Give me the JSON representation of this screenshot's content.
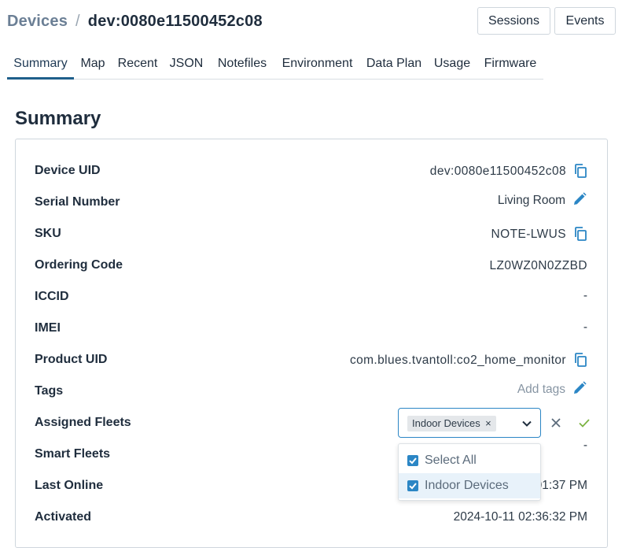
{
  "breadcrumb": {
    "parent": "Devices",
    "separator": "/",
    "current": "dev:0080e11500452c08"
  },
  "header_buttons": {
    "sessions": "Sessions",
    "events": "Events"
  },
  "tabs": [
    {
      "label": "Summary",
      "active": true
    },
    {
      "label": "Map"
    },
    {
      "label": "Recent"
    },
    {
      "label": "JSON"
    },
    {
      "label": "Notefiles"
    },
    {
      "label": "Environment"
    },
    {
      "label": "Data Plan"
    },
    {
      "label": "Usage"
    },
    {
      "label": "Firmware"
    }
  ],
  "section_title": "Summary",
  "fields": {
    "device_uid": {
      "label": "Device UID",
      "value": "dev:0080e11500452c08"
    },
    "serial_number": {
      "label": "Serial Number",
      "value": "Living Room"
    },
    "sku": {
      "label": "SKU",
      "value": "NOTE-LWUS"
    },
    "ordering_code": {
      "label": "Ordering Code",
      "value": "LZ0WZ0N0ZZBD"
    },
    "iccid": {
      "label": "ICCID",
      "value": "-"
    },
    "imei": {
      "label": "IMEI",
      "value": "-"
    },
    "product_uid": {
      "label": "Product UID",
      "value": "com.blues.tvantoll:co2_home_monitor"
    },
    "tags": {
      "label": "Tags",
      "value": "Add tags"
    },
    "assigned_fleets": {
      "label": "Assigned Fleets"
    },
    "smart_fleets": {
      "label": "Smart Fleets",
      "value": "-"
    },
    "last_online": {
      "label": "Last Online",
      "value": "01:37 PM"
    },
    "activated": {
      "label": "Activated",
      "value": "2024-10-11 02:36:32 PM"
    }
  },
  "fleet_select": {
    "chip": "Indoor Devices",
    "chip_remove": "×",
    "options": [
      {
        "label": "Select All",
        "checked": true
      },
      {
        "label": "Indoor Devices",
        "checked": true
      }
    ]
  },
  "colors": {
    "accent": "#2b86c5",
    "confirm": "#7cb342",
    "tab_active_underline": "#1f5f8b"
  },
  "icons": {
    "copy": "copy-icon",
    "edit": "pencil-icon",
    "cancel": "close-icon",
    "confirm": "check-icon",
    "dropdown": "chevron-down-icon",
    "checkbox": "checkbox-checked-icon"
  }
}
